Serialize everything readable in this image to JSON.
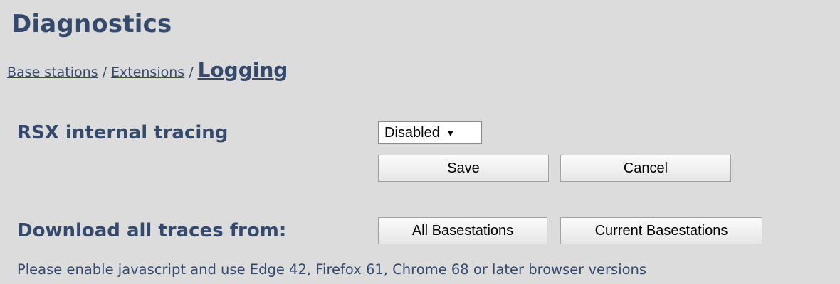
{
  "page": {
    "title": "Diagnostics"
  },
  "breadcrumb": {
    "items": [
      "Base stations",
      "Extensions"
    ],
    "separator": "/",
    "current": "Logging"
  },
  "tracing": {
    "label": "RSX internal tracing",
    "select_value": "Disabled",
    "caret": "▼",
    "save_label": "Save",
    "cancel_label": "Cancel"
  },
  "download": {
    "label": "Download all traces from:",
    "all_label": "All Basestations",
    "current_label": "Current Basestations"
  },
  "note": "Please enable javascript and use Edge 42, Firefox 61, Chrome 68 or later browser versions",
  "colors": {
    "background": "#dcdcdc",
    "heading": "#34496b"
  }
}
